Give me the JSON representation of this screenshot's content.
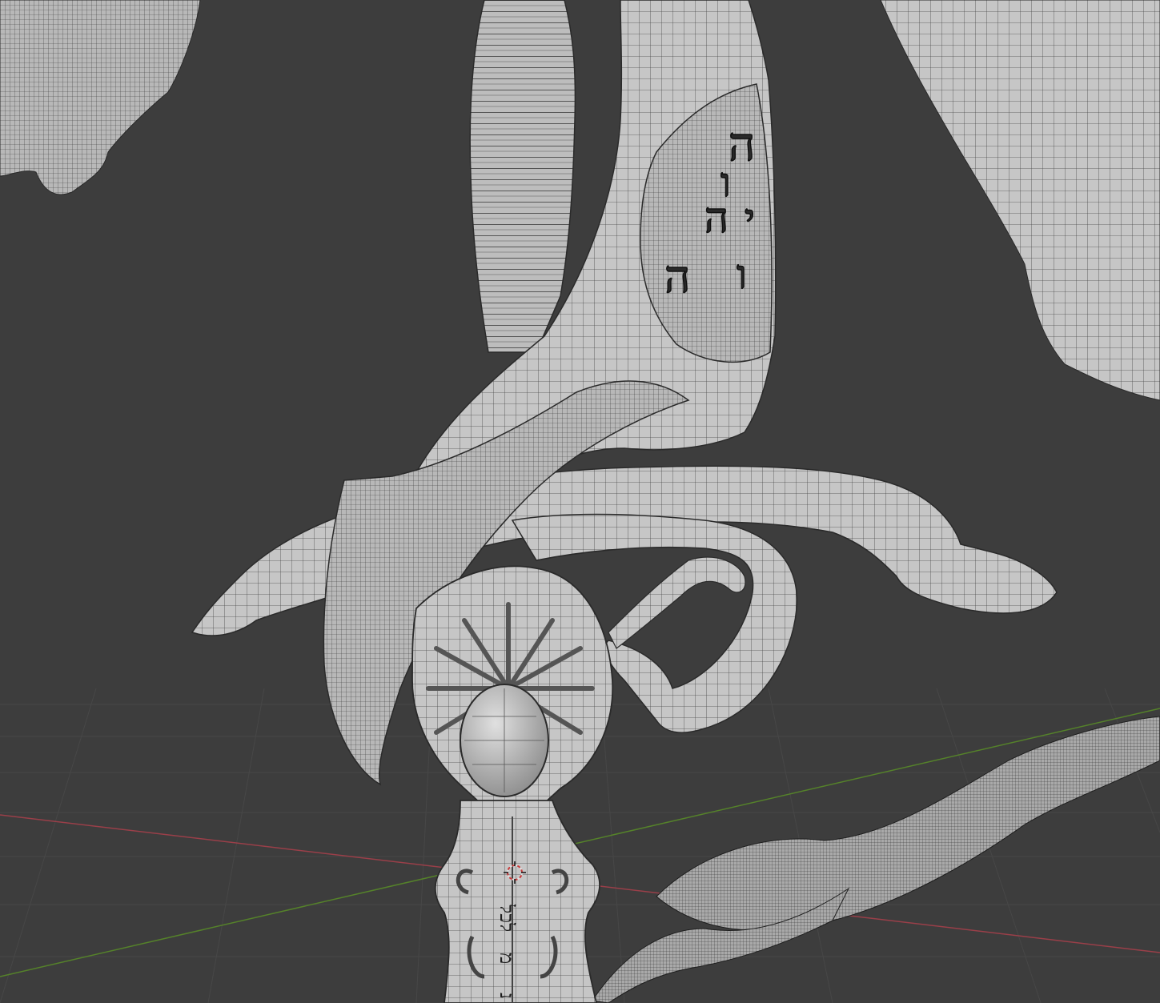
{
  "viewport": {
    "background": "#3d3d3d",
    "grid_color": "#484848",
    "x_axis_color": "#a0404a",
    "y_axis_color": "#5a8a2a",
    "mesh_color": "#c8c8c8",
    "wire_color": "#2a2a2a"
  },
  "guard_inscription": {
    "glyph_1": "ה",
    "glyph_2": "ו",
    "glyph_3": "ה",
    "glyph_4": "י",
    "glyph_5": "ו",
    "glyph_6": "ה"
  },
  "blade_inscription": {
    "line_1": "לכל",
    "line_2": "מ",
    "line_3": "נ"
  }
}
